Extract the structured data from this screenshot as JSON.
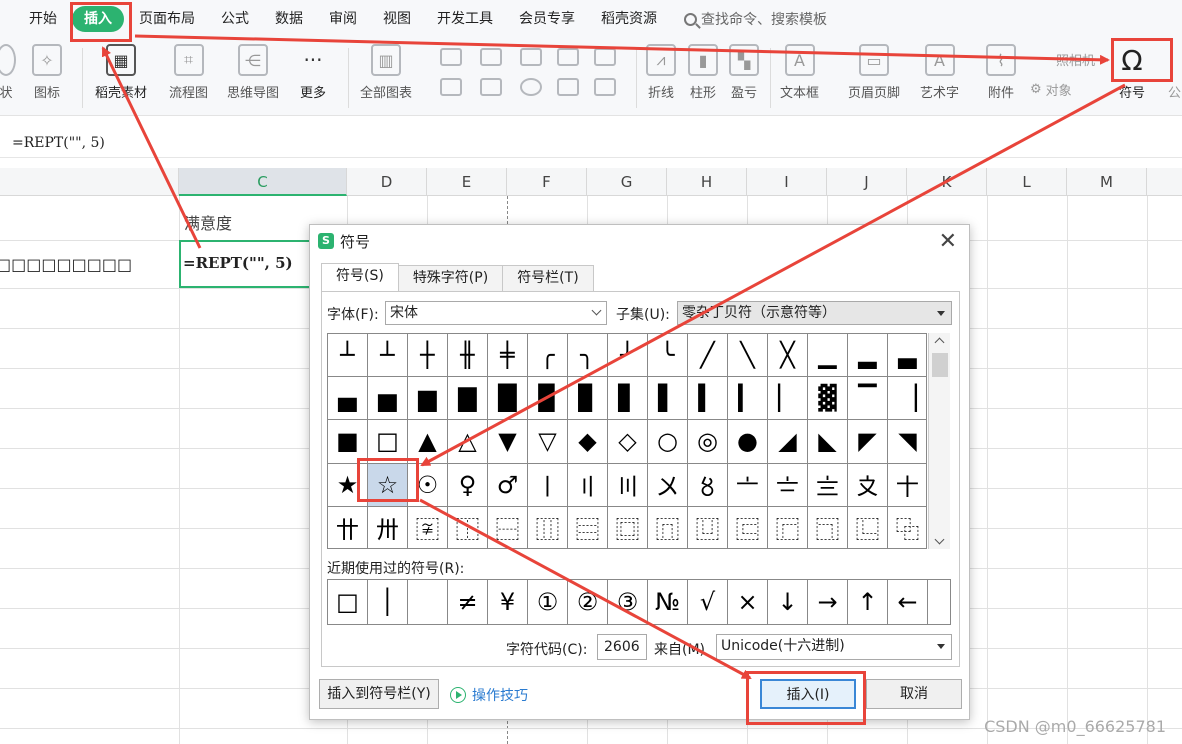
{
  "menubar": {
    "tabs": [
      "开始",
      "插入",
      "页面布局",
      "公式",
      "数据",
      "审阅",
      "视图",
      "开发工具",
      "会员专享",
      "稻壳资源"
    ],
    "active_tab": "插入",
    "search_placeholder": "查找命令、搜索模板"
  },
  "ribbon": {
    "items": {
      "partial_left": "状",
      "icons": "图标",
      "daoke": "稻壳素材",
      "flowchart": "流程图",
      "mindmap": "思维导图",
      "more": "更多",
      "all_charts": "全部图表",
      "line": "折线",
      "column": "柱形",
      "winloss": "盈亏",
      "textbox": "文本框",
      "header_footer": "页眉页脚",
      "wordart": "艺术字",
      "attachment": "附件",
      "object": "对象",
      "partial_top": "照相机",
      "symbol": "符号",
      "partial_right": "公"
    },
    "symbol_glyph": "Ω"
  },
  "formula_bar": {
    "value": "=REPT(\"\", 5)"
  },
  "sheet": {
    "columns": [
      "C",
      "D",
      "E",
      "F",
      "G",
      "H",
      "I",
      "J",
      "K",
      "L",
      "M"
    ],
    "header_cell": "满意度",
    "left_cell": "□□□□□□□□□",
    "active_cell_value": "=REPT(\"\", 5)"
  },
  "dialog": {
    "title": "符号",
    "logo": "S",
    "close": "✕",
    "tabs": [
      "符号(S)",
      "特殊字符(P)",
      "符号栏(T)"
    ],
    "font_label": "字体(F):",
    "font_value": "宋体",
    "subset_label": "子集(U):",
    "subset_value": "零杂丁贝符（示意符等）",
    "symbols": [
      "┴",
      "┴",
      "┼",
      "╫",
      "╪",
      "╭",
      "╮",
      "╯",
      "╰",
      "╱",
      "╲",
      "╳",
      "▁",
      "▂",
      "▃",
      "▄",
      "▅",
      "▆",
      "▇",
      "█",
      "▉",
      "▊",
      "▋",
      "▌",
      "▍",
      "▎",
      "▏",
      "▓",
      "▔",
      "▕",
      "■",
      "□",
      "▲",
      "△",
      "▼",
      "▽",
      "◆",
      "◇",
      "○",
      "◎",
      "●",
      "◢",
      "◣",
      "◤",
      "◥",
      "★",
      "☆",
      "☉",
      "♀",
      "♂",
      "〡",
      "〢",
      "〣",
      "〤",
      "〥",
      "〦",
      "〧",
      "〨",
      "〩",
      "〸",
      "〹",
      "〺",
      "〾",
      "⿰",
      "⿱",
      "⿲",
      "⿳",
      "⿴",
      "⿵",
      "⿶",
      "⿷",
      "⿸",
      "⿹",
      "⿺",
      "⿻"
    ],
    "selected_symbol": "☆",
    "recent_label": "近期使用过的符号(R):",
    "recent_symbols": [
      "□",
      "│",
      " ",
      "≠",
      "¥",
      "①",
      "②",
      "③",
      "№",
      "√",
      "×",
      "↓",
      "→",
      "↑",
      "←"
    ],
    "code_label": "字符代码(C):",
    "code_value": "2606",
    "from_label": "来自(M)",
    "from_value": "Unicode(十六进制)",
    "add_to_bar_button": "插入到符号栏(Y)",
    "tips_link": "操作技巧",
    "insert_button": "插入(I)",
    "cancel_button": "取消"
  },
  "watermark": "CSDN @m0_66625781",
  "annotation_color": "#e8443a",
  "accent_color": "#2cb370"
}
